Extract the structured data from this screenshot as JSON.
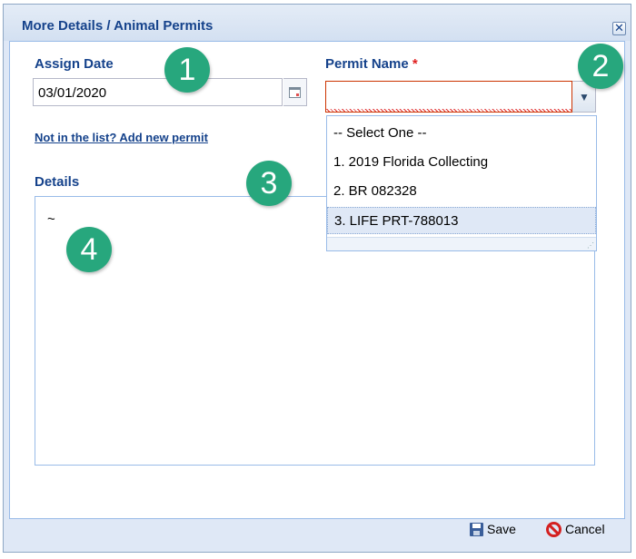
{
  "window": {
    "title": "More Details / Animal Permits",
    "close_glyph": "✕"
  },
  "form": {
    "assign_date_label": "Assign Date",
    "assign_date_value": "03/01/2020",
    "permit_name_label": "Permit Name",
    "required_marker": "*",
    "permit_name_value": "",
    "add_permit_link": "Not in the list? Add new permit",
    "details_label": "Details",
    "details_value": "~"
  },
  "dropdown": {
    "options": [
      "-- Select One --",
      "1. 2019 Florida Collecting",
      "2. BR 082328",
      "3. LIFE PRT-788013"
    ],
    "highlighted_index": 3
  },
  "callouts": [
    "1",
    "2",
    "3",
    "4"
  ],
  "footer": {
    "save_label": "Save",
    "cancel_label": "Cancel"
  },
  "colors": {
    "label_blue": "#15428b",
    "callout_green": "#27a77d",
    "required_red": "#e02020"
  },
  "icons": [
    "close-icon",
    "calendar-icon",
    "chevron-down-icon",
    "save-disk-icon",
    "cancel-icon"
  ]
}
